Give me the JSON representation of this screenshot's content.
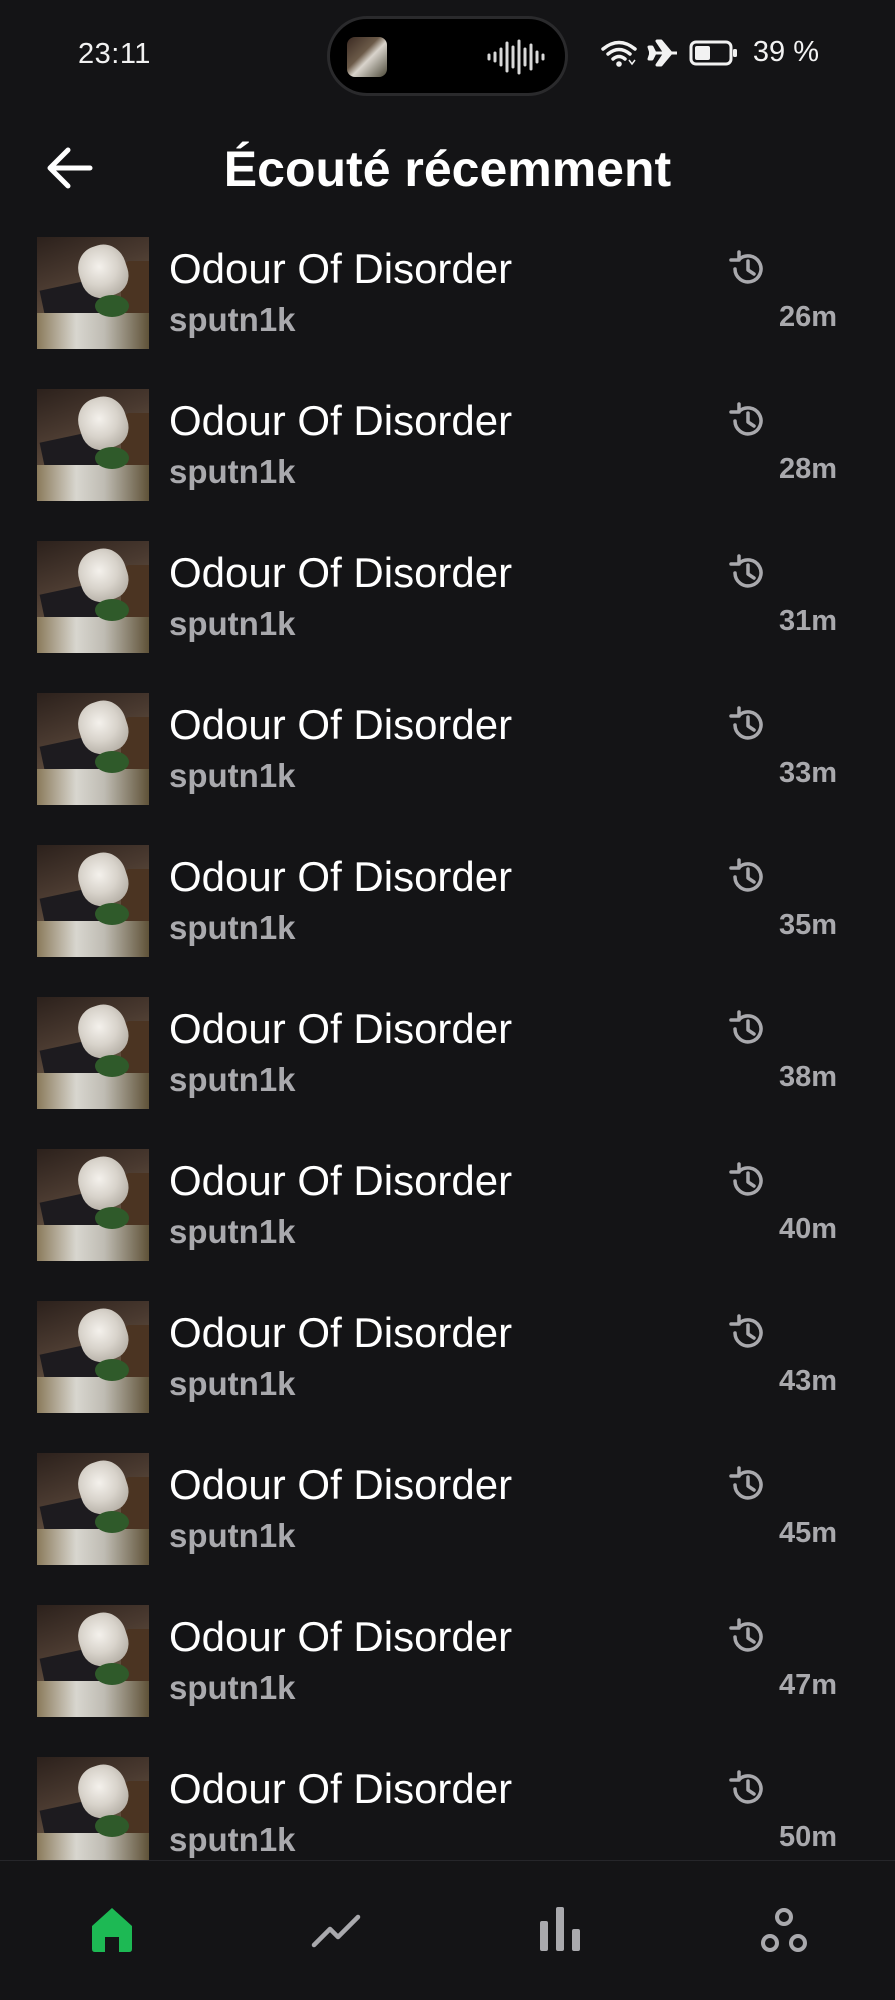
{
  "status_bar": {
    "time": "23:11",
    "battery_text": "39 %",
    "icons": [
      "wifi-icon",
      "airplane-icon",
      "battery-icon"
    ]
  },
  "header": {
    "title": "Écouté récemment",
    "back_icon": "arrow-left-icon"
  },
  "tracks": [
    {
      "title": "Odour Of Disorder",
      "artist": "sputn1k",
      "time": "26m"
    },
    {
      "title": "Odour Of Disorder",
      "artist": "sputn1k",
      "time": "28m"
    },
    {
      "title": "Odour Of Disorder",
      "artist": "sputn1k",
      "time": "31m"
    },
    {
      "title": "Odour Of Disorder",
      "artist": "sputn1k",
      "time": "33m"
    },
    {
      "title": "Odour Of Disorder",
      "artist": "sputn1k",
      "time": "35m"
    },
    {
      "title": "Odour Of Disorder",
      "artist": "sputn1k",
      "time": "38m"
    },
    {
      "title": "Odour Of Disorder",
      "artist": "sputn1k",
      "time": "40m"
    },
    {
      "title": "Odour Of Disorder",
      "artist": "sputn1k",
      "time": "43m"
    },
    {
      "title": "Odour Of Disorder",
      "artist": "sputn1k",
      "time": "45m"
    },
    {
      "title": "Odour Of Disorder",
      "artist": "sputn1k",
      "time": "47m"
    },
    {
      "title": "Odour Of Disorder",
      "artist": "sputn1k",
      "time": "50m"
    }
  ],
  "bottom_nav": {
    "items": [
      "home-icon",
      "trend-icon",
      "stats-icon",
      "social-icon"
    ],
    "active": "home-icon"
  },
  "colors": {
    "background": "#141416",
    "accent": "#1db954",
    "secondary_text": "#a9a9ad"
  }
}
